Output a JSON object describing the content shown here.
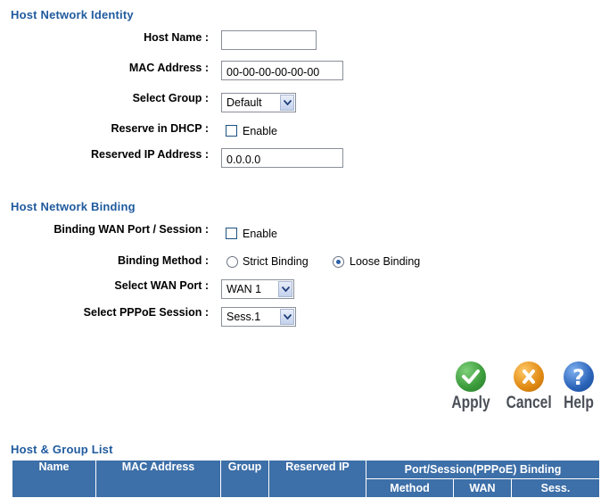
{
  "identity": {
    "title": "Host Network Identity",
    "host_name_label": "Host Name :",
    "host_name_value": "",
    "mac_label": "MAC Address :",
    "mac_value": "00-00-00-00-00-00",
    "group_label": "Select Group :",
    "group_value": "Default",
    "reserve_label": "Reserve in DHCP :",
    "reserve_option": "Enable",
    "reserve_checked": false,
    "reserved_ip_label": "Reserved IP Address :",
    "reserved_ip_value": "0.0.0.0"
  },
  "binding": {
    "title": "Host Network Binding",
    "binding_label": "Binding WAN Port / Session :",
    "binding_option": "Enable",
    "binding_checked": false,
    "method_label": "Binding Method :",
    "method_strict": "Strict Binding",
    "method_loose": "Loose Binding",
    "method_selected": "Loose Binding",
    "wan_port_label": "Select WAN Port :",
    "wan_port_value": "WAN 1",
    "pppoe_label": "Select PPPoE Session :",
    "pppoe_value": "Sess.1"
  },
  "actions": {
    "apply": "Apply",
    "cancel": "Cancel",
    "help": "Help",
    "apply_color": "#3a9a3a",
    "cancel_color": "#e08a12",
    "help_color": "#2a63b8"
  },
  "list": {
    "title": "Host & Group List",
    "headers": {
      "name": "Name",
      "mac": "MAC Address",
      "group": "Group",
      "reserved_ip": "Reserved IP",
      "binding": "Port/Session(PPPoE) Binding",
      "method": "Method",
      "wan": "WAN",
      "sess": "Sess."
    },
    "header_color": "#3d6fa8"
  }
}
